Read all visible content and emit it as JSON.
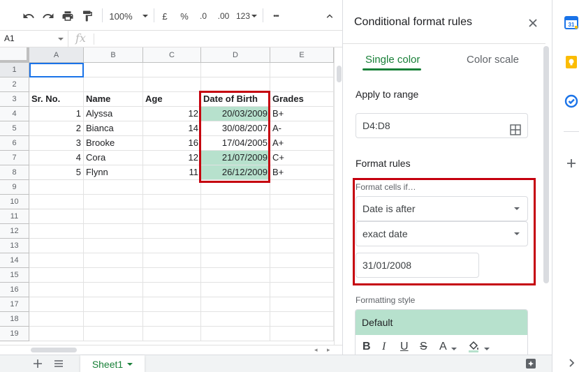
{
  "toolbar": {
    "zoom": "100%",
    "currency": "£",
    "percent": "%",
    "decrease_decimal": ".0",
    "increase_decimal": ".00",
    "more_formats": "123",
    "more": "•••"
  },
  "formula_bar": {
    "cell_ref": "A1",
    "fx": "fx",
    "value": ""
  },
  "grid": {
    "columns": [
      "A",
      "B",
      "C",
      "D",
      "E"
    ],
    "rows": [
      "1",
      "2",
      "3",
      "4",
      "5",
      "6",
      "7",
      "8",
      "9",
      "10",
      "11",
      "12",
      "13",
      "14",
      "15",
      "16",
      "17",
      "18",
      "19"
    ],
    "headers": [
      "Sr. No.",
      "Name",
      "Age",
      "Date of Birth",
      "Grades"
    ],
    "data": [
      [
        "1",
        "Alyssa",
        "12",
        "20/03/2009",
        "B+"
      ],
      [
        "2",
        "Bianca",
        "14",
        "30/08/2007",
        "A-"
      ],
      [
        "3",
        "Brooke",
        "16",
        "17/04/2005",
        "A+"
      ],
      [
        "4",
        "Cora",
        "12",
        "21/07/2009",
        "C+"
      ],
      [
        "5",
        "Flynn",
        "11",
        "26/12/2009",
        "B+"
      ]
    ],
    "highlight_color": "#b7e1cd"
  },
  "sheets": {
    "tabs": [
      "Sheet1"
    ]
  },
  "panel": {
    "title": "Conditional format rules",
    "tabs": [
      "Single color",
      "Color scale"
    ],
    "apply_to_range_label": "Apply to range",
    "range": "D4:D8",
    "format_rules_label": "Format rules",
    "format_cells_if_label": "Format cells if…",
    "condition": "Date is after",
    "date_option": "exact date",
    "date_value": "31/01/2008",
    "formatting_style_label": "Formatting style",
    "style_preset": "Default",
    "style_tools": {
      "bold": "B",
      "italic": "I",
      "underline": "U",
      "strikethrough": "S",
      "text_color": "A"
    },
    "accent_color": "#188038"
  },
  "colors": {
    "annotation_red": "#c5000e",
    "selection_blue": "#1a73e8"
  }
}
